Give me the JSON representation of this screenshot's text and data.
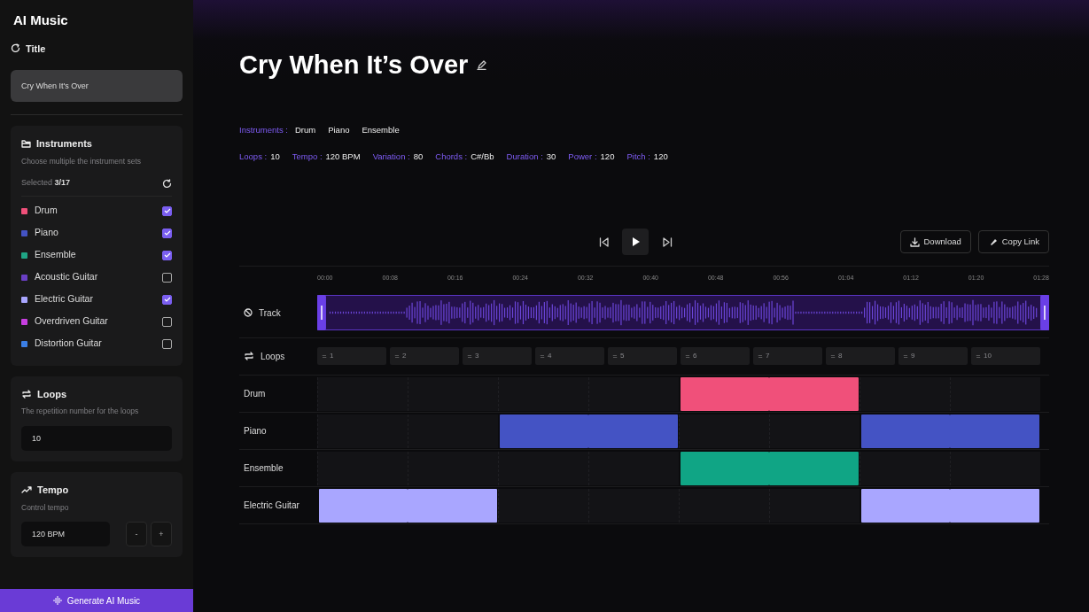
{
  "app": {
    "title": "AI Music"
  },
  "sidebar": {
    "title_section": {
      "label": "Title",
      "value": "Cry When It's Over"
    },
    "instruments": {
      "label": "Instruments",
      "hint": "Choose multiple the instrument sets",
      "selected_label": "Selected",
      "selected_count": "3/17",
      "items": [
        {
          "name": "Drum",
          "color": "#f0507a",
          "checked": true
        },
        {
          "name": "Piano",
          "color": "#4453c4",
          "checked": true
        },
        {
          "name": "Ensemble",
          "color": "#1fa585",
          "checked": true
        },
        {
          "name": "Acoustic Guitar",
          "color": "#6a3fc4",
          "checked": false
        },
        {
          "name": "Electric Guitar",
          "color": "#a9a6ff",
          "checked": true
        },
        {
          "name": "Overdriven Guitar",
          "color": "#c73ee0",
          "checked": false
        },
        {
          "name": "Distortion Guitar",
          "color": "#3b7fe6",
          "checked": false
        }
      ]
    },
    "loops": {
      "label": "Loops",
      "hint": "The repetition number for the loops",
      "value": "10"
    },
    "tempo": {
      "label": "Tempo",
      "hint": "Control tempo",
      "value": "120 BPM",
      "minus": "-",
      "plus": "+"
    },
    "generate_button": "Generate AI Music"
  },
  "song": {
    "title": "Cry When It’s Over",
    "instruments_label": "Instruments :",
    "instruments": [
      "Drum",
      "Piano",
      "Ensemble"
    ],
    "params": [
      {
        "label": "Loops :",
        "value": "10"
      },
      {
        "label": "Tempo :",
        "value": "120 BPM"
      },
      {
        "label": "Variation :",
        "value": "80"
      },
      {
        "label": "Chords :",
        "value": "C#/Bb"
      },
      {
        "label": "Duration :",
        "value": "30"
      },
      {
        "label": "Power :",
        "value": "120"
      },
      {
        "label": "Pitch :",
        "value": "120"
      }
    ]
  },
  "actions": [
    "Download",
    "Copy Link"
  ],
  "timeline": {
    "ticks": [
      "00:00",
      "00:08",
      "00:16",
      "00:24",
      "00:32",
      "00:40",
      "00:48",
      "00:56",
      "01:04",
      "01:12",
      "01:20",
      "01:28"
    ],
    "track_label": "Track",
    "loops_label": "Loops",
    "loops": [
      "1",
      "2",
      "3",
      "4",
      "5",
      "6",
      "7",
      "8",
      "9",
      "10"
    ],
    "lanes": [
      {
        "name": "Drum",
        "color": "#f0507a",
        "slots": [
          false,
          false,
          false,
          false,
          true,
          true,
          false,
          false
        ]
      },
      {
        "name": "Piano",
        "color": "#4453c4",
        "slots": [
          false,
          false,
          true,
          true,
          false,
          false,
          true,
          true
        ]
      },
      {
        "name": "Ensemble",
        "color": "#10a585",
        "slots": [
          false,
          false,
          false,
          false,
          true,
          true,
          false,
          false
        ]
      },
      {
        "name": "Electric Guitar",
        "color": "#a9a6ff",
        "slots": [
          true,
          true,
          false,
          false,
          false,
          false,
          true,
          true
        ]
      }
    ]
  }
}
